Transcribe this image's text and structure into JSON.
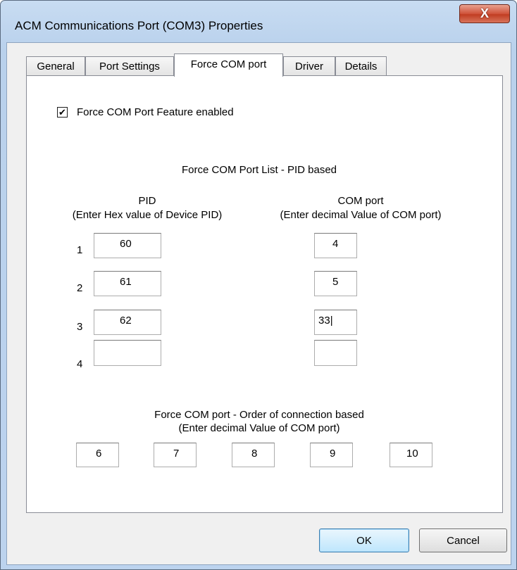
{
  "window": {
    "title": "ACM Communications Port (COM3) Properties",
    "close_glyph": "X"
  },
  "tabs": [
    {
      "label": "General"
    },
    {
      "label": "Port Settings"
    },
    {
      "label": "Force COM port"
    },
    {
      "label": "Driver"
    },
    {
      "label": "Details"
    }
  ],
  "feature": {
    "checkbox_label": "Force COM Port Feature enabled",
    "checked_glyph": "✔"
  },
  "pid_section": {
    "heading": "Force COM Port List - PID based",
    "pid_header": "PID",
    "pid_subheader": "(Enter Hex value of Device PID)",
    "com_header": "COM port",
    "com_subheader": "(Enter decimal Value of COM port)",
    "rows": [
      {
        "index": "1",
        "pid": "60",
        "com": "4"
      },
      {
        "index": "2",
        "pid": "61",
        "com": "5"
      },
      {
        "index": "3",
        "pid": "62",
        "com": "33"
      },
      {
        "index": "4",
        "pid": "",
        "com": ""
      }
    ]
  },
  "order_section": {
    "heading": "Force COM port - Order of connection based",
    "subheading": "(Enter decimal Value of COM port)",
    "values": [
      "6",
      "7",
      "8",
      "9",
      "10"
    ]
  },
  "buttons": {
    "ok": "OK",
    "cancel": "Cancel"
  }
}
